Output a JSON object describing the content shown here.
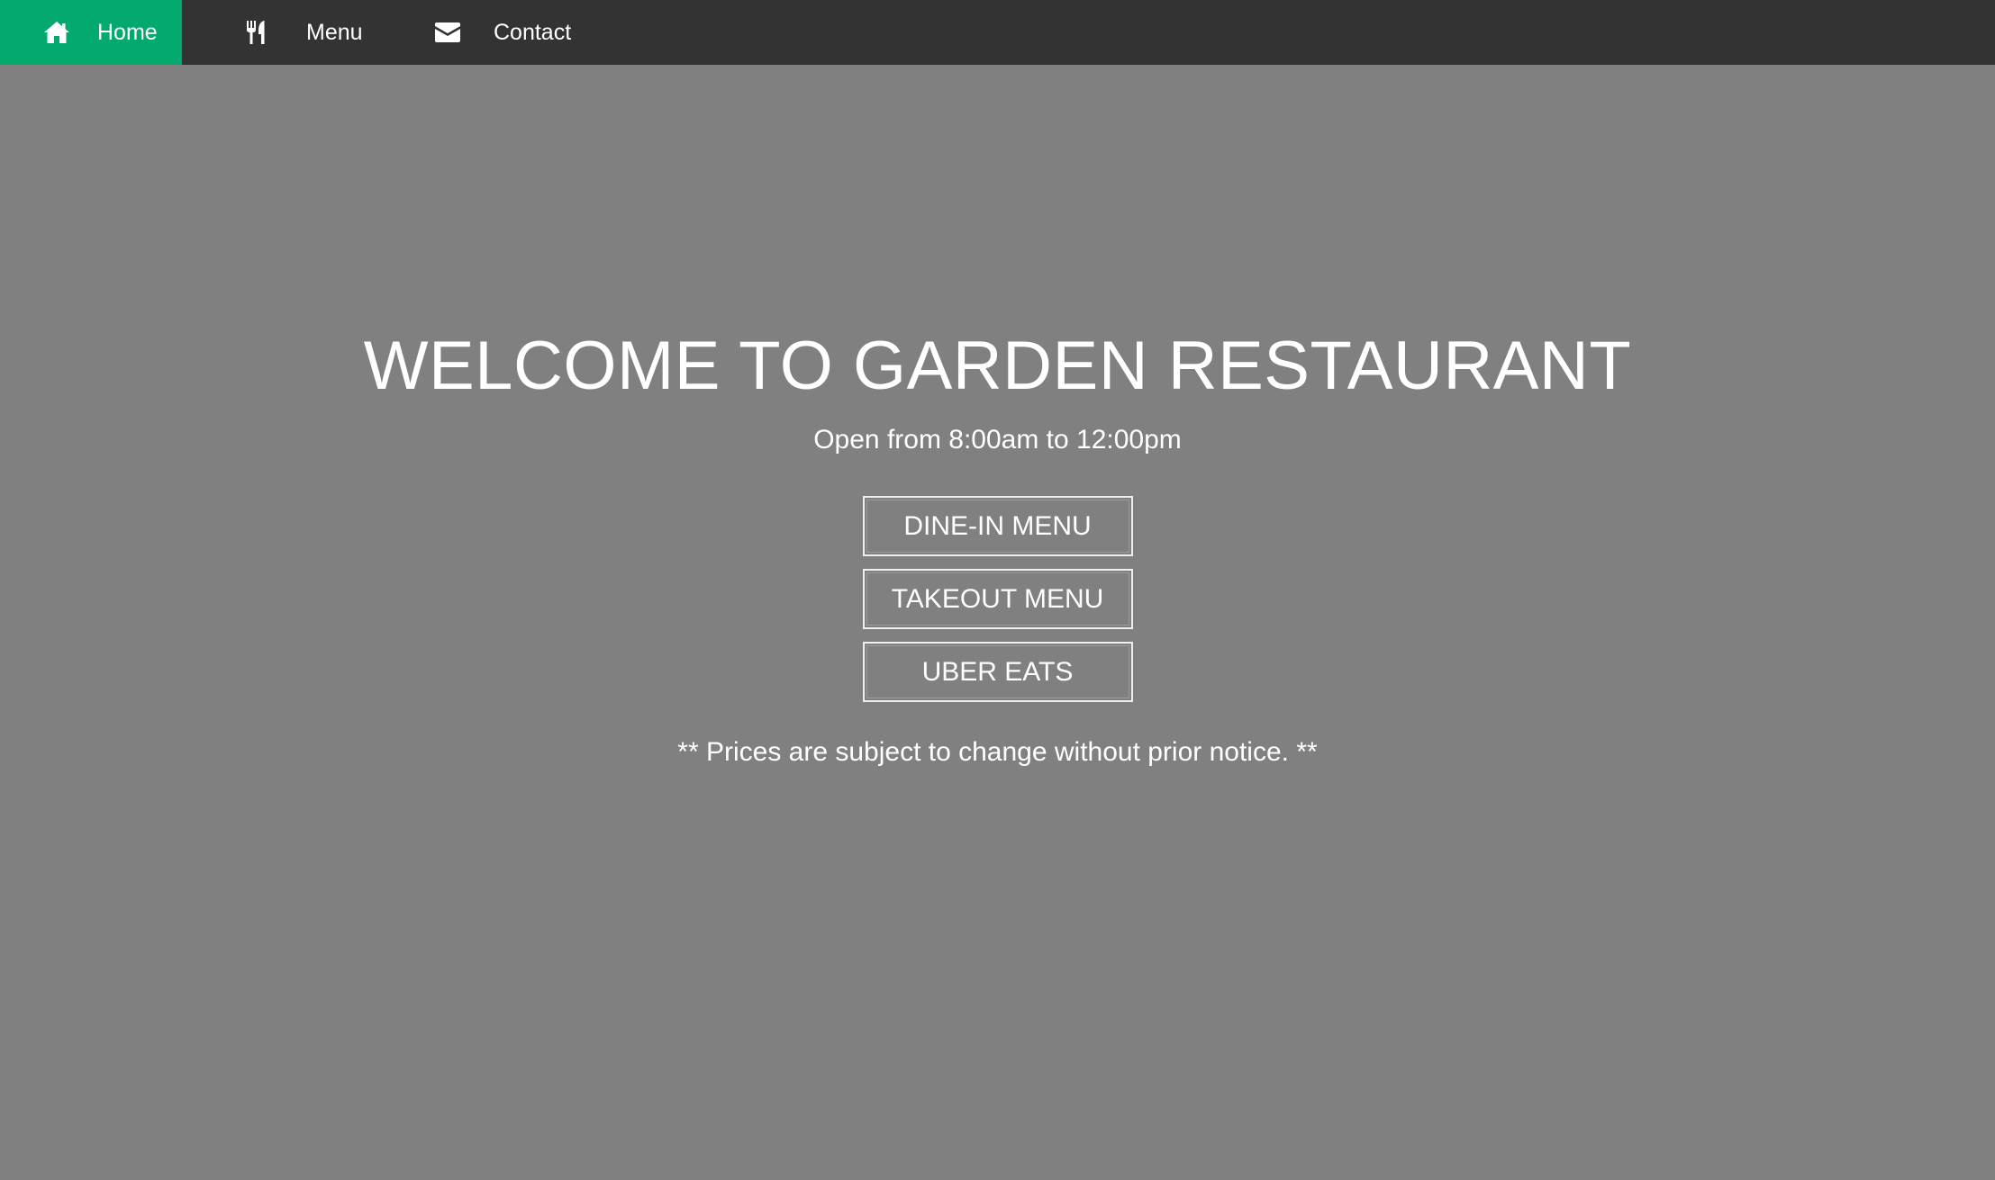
{
  "nav": {
    "items": [
      {
        "label": "Home",
        "icon": "home-icon",
        "active": true
      },
      {
        "label": "Menu",
        "icon": "utensils-icon",
        "active": false
      },
      {
        "label": "Contact",
        "icon": "envelope-icon",
        "active": false
      }
    ],
    "active_color": "#04AA6D",
    "background_color": "#333333"
  },
  "hero": {
    "title": "WELCOME TO GARDEN RESTAURANT",
    "hours": "Open from 8:00am to 12:00pm",
    "buttons": [
      {
        "label": "DINE-IN MENU"
      },
      {
        "label": "TAKEOUT MENU"
      },
      {
        "label": "UBER EATS"
      }
    ],
    "note": "** Prices are subject to change without prior notice. **"
  },
  "page": {
    "background_color": "#808080"
  }
}
